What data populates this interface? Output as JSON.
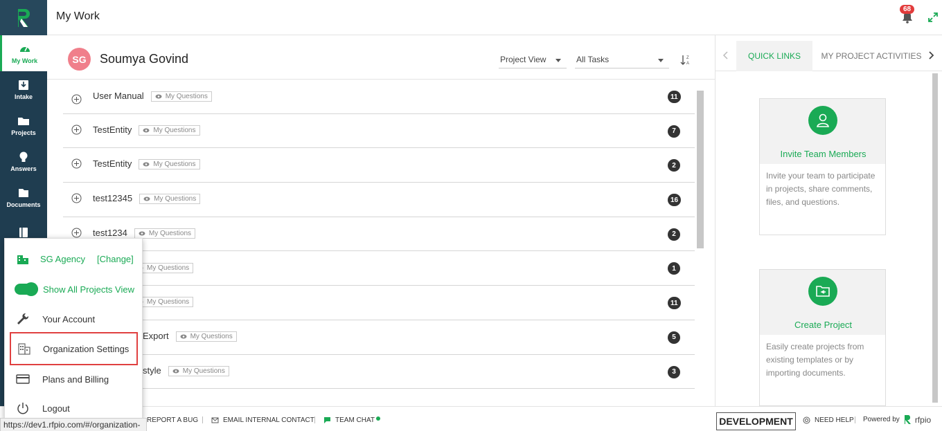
{
  "header": {
    "title": "My Work",
    "notification_count": "68"
  },
  "nav": {
    "items": [
      {
        "label": "My Work",
        "icon": "dashboard-icon"
      },
      {
        "label": "Intake",
        "icon": "download-icon"
      },
      {
        "label": "Projects",
        "icon": "folder-icon"
      },
      {
        "label": "Answers",
        "icon": "bulb-icon"
      },
      {
        "label": "Documents",
        "icon": "documents-icon"
      },
      {
        "label": "",
        "icon": "book-icon"
      }
    ]
  },
  "main": {
    "user_initials": "SG",
    "user_name": "Soumya Govind",
    "project_view": "Project View",
    "task_filter": "All Tasks",
    "tag_label": "My Questions",
    "rows": [
      {
        "title": "User Manual",
        "count": "11"
      },
      {
        "title": "TestEntity",
        "count": "7"
      },
      {
        "title": "TestEntity",
        "count": "2"
      },
      {
        "title": "test12345",
        "count": "16"
      },
      {
        "title": "test1234",
        "count": "2"
      },
      {
        "title": "",
        "count": "1"
      },
      {
        "title": "",
        "count": "11"
      },
      {
        "title": "Export",
        "count": "5"
      },
      {
        "title": "style",
        "count": "3"
      }
    ]
  },
  "right": {
    "tabs": [
      "QUICK LINKS",
      "MY PROJECT ACTIVITIES"
    ],
    "cards": [
      {
        "title": "Invite Team Members",
        "desc": "Invite your team to participate in projects, share comments, files, and questions."
      },
      {
        "title": "Create Project",
        "desc": "Easily create projects from existing templates or by importing documents."
      }
    ]
  },
  "popup": {
    "agency": "SG Agency",
    "change": "[Change]",
    "show_all": "Show All Projects View",
    "account": "Your Account",
    "org_settings": "Organization Settings",
    "plans": "Plans and Billing",
    "logout": "Logout"
  },
  "footer": {
    "report_bug": "REPORT A BUG",
    "email_contact": "EMAIL INTERNAL CONTACT",
    "team_chat": "TEAM CHAT",
    "env": "DEVELOPMENT",
    "need_help": "NEED HELP",
    "powered_by": "Powered by",
    "brand": "rfpio",
    "status_url": "https://dev1.rfpio.com/#/organization-"
  },
  "colors": {
    "brand_green": "#1aaa55",
    "nav_bg": "#1f3d50",
    "badge_red": "#e23b3b",
    "avatar_pink": "#f07f8b"
  }
}
